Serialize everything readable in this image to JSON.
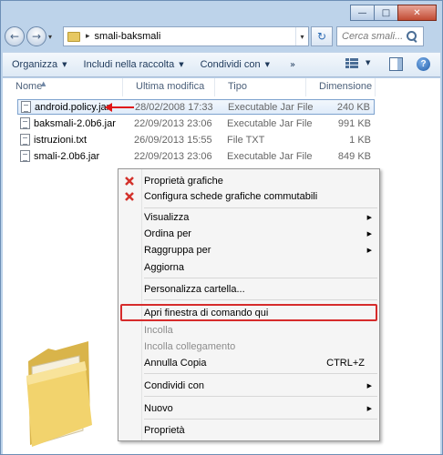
{
  "window": {
    "minimize_icon": "minimize-icon",
    "maximize_icon": "maximize-icon",
    "close_icon": "close-icon"
  },
  "address": {
    "path": "smali-baksmali",
    "search_placeholder": "Cerca smali..."
  },
  "toolbar": {
    "organize": "Organizza",
    "include": "Includi nella raccolta",
    "share": "Condividi con",
    "more": "»"
  },
  "columns": {
    "name": "Nome",
    "modified": "Ultima modifica",
    "type": "Tipo",
    "size": "Dimensione"
  },
  "files": [
    {
      "name": "android.policy.jar",
      "date": "28/02/2008 17:33",
      "type": "Executable Jar File",
      "size": "240 KB"
    },
    {
      "name": "baksmali-2.0b6.jar",
      "date": "22/09/2013 23:06",
      "type": "Executable Jar File",
      "size": "991 KB"
    },
    {
      "name": "istruzioni.txt",
      "date": "26/09/2013 15:55",
      "type": "File TXT",
      "size": "1 KB"
    },
    {
      "name": "smali-2.0b6.jar",
      "date": "22/09/2013 23:06",
      "type": "Executable Jar File",
      "size": "849 KB"
    }
  ],
  "context_menu": {
    "graphics_props": "Proprietà grafiche",
    "configure_gpus": "Configura schede grafiche commutabili",
    "view": "Visualizza",
    "sort_by": "Ordina per",
    "group_by": "Raggruppa per",
    "refresh": "Aggiorna",
    "customize": "Personalizza cartella...",
    "open_cmd": "Apri finestra di comando qui",
    "paste": "Incolla",
    "paste_link": "Incolla collegamento",
    "undo_copy": "Annulla Copia",
    "undo_shortcut": "CTRL+Z",
    "share_with": "Condividi con",
    "new": "Nuovo",
    "properties": "Proprietà"
  }
}
